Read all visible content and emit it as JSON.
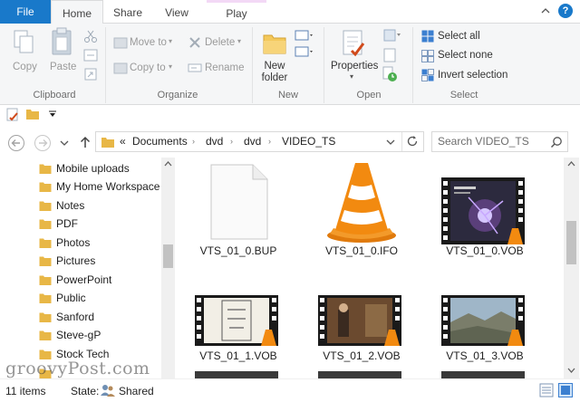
{
  "ribbon": {
    "tabs": [
      "File",
      "Home",
      "Share",
      "View",
      "Play"
    ],
    "clipboard": {
      "copy": "Copy",
      "paste": "Paste",
      "label": "Clipboard"
    },
    "organize": {
      "move_to": "Move to",
      "copy_to": "Copy to",
      "delete": "Delete",
      "rename": "Rename",
      "label": "Organize"
    },
    "new": {
      "new_folder_line1": "New",
      "new_folder_line2": "folder",
      "label": "New"
    },
    "open": {
      "properties": "Properties",
      "label": "Open"
    },
    "select": {
      "select_all": "Select all",
      "select_none": "Select none",
      "invert_selection": "Invert selection",
      "label": "Select"
    },
    "help": "?"
  },
  "address": {
    "overflow": "«",
    "crumbs": [
      "Documents",
      "dvd",
      "dvd",
      "VIDEO_TS"
    ],
    "search_placeholder": "Search VIDEO_TS"
  },
  "nav": {
    "items": [
      "Mobile uploads",
      "My Home Workspace",
      "Notes",
      "PDF",
      "Photos",
      "Pictures",
      "PowerPoint",
      "Public",
      "Sanford",
      "Steve-gP",
      "Stock Tech"
    ]
  },
  "files": [
    {
      "name": "VTS_01_0.BUP",
      "icon": "blank-file-icon"
    },
    {
      "name": "VTS_01_0.IFO",
      "icon": "vlc-cone-icon"
    },
    {
      "name": "VTS_01_0.VOB",
      "icon": "video-thumbnail-icon"
    },
    {
      "name": "VTS_01_1.VOB",
      "icon": "video-thumbnail-icon"
    },
    {
      "name": "VTS_01_2.VOB",
      "icon": "video-thumbnail-icon"
    },
    {
      "name": "VTS_01_3.VOB",
      "icon": "video-thumbnail-icon"
    }
  ],
  "status": {
    "count": "11 items",
    "state_label": "State:",
    "state_value": "Shared"
  },
  "watermark": "groovyPost.com",
  "colors": {
    "accent": "#1979ca",
    "folder": "#e8b746",
    "vlc_orange": "#f28a10"
  }
}
